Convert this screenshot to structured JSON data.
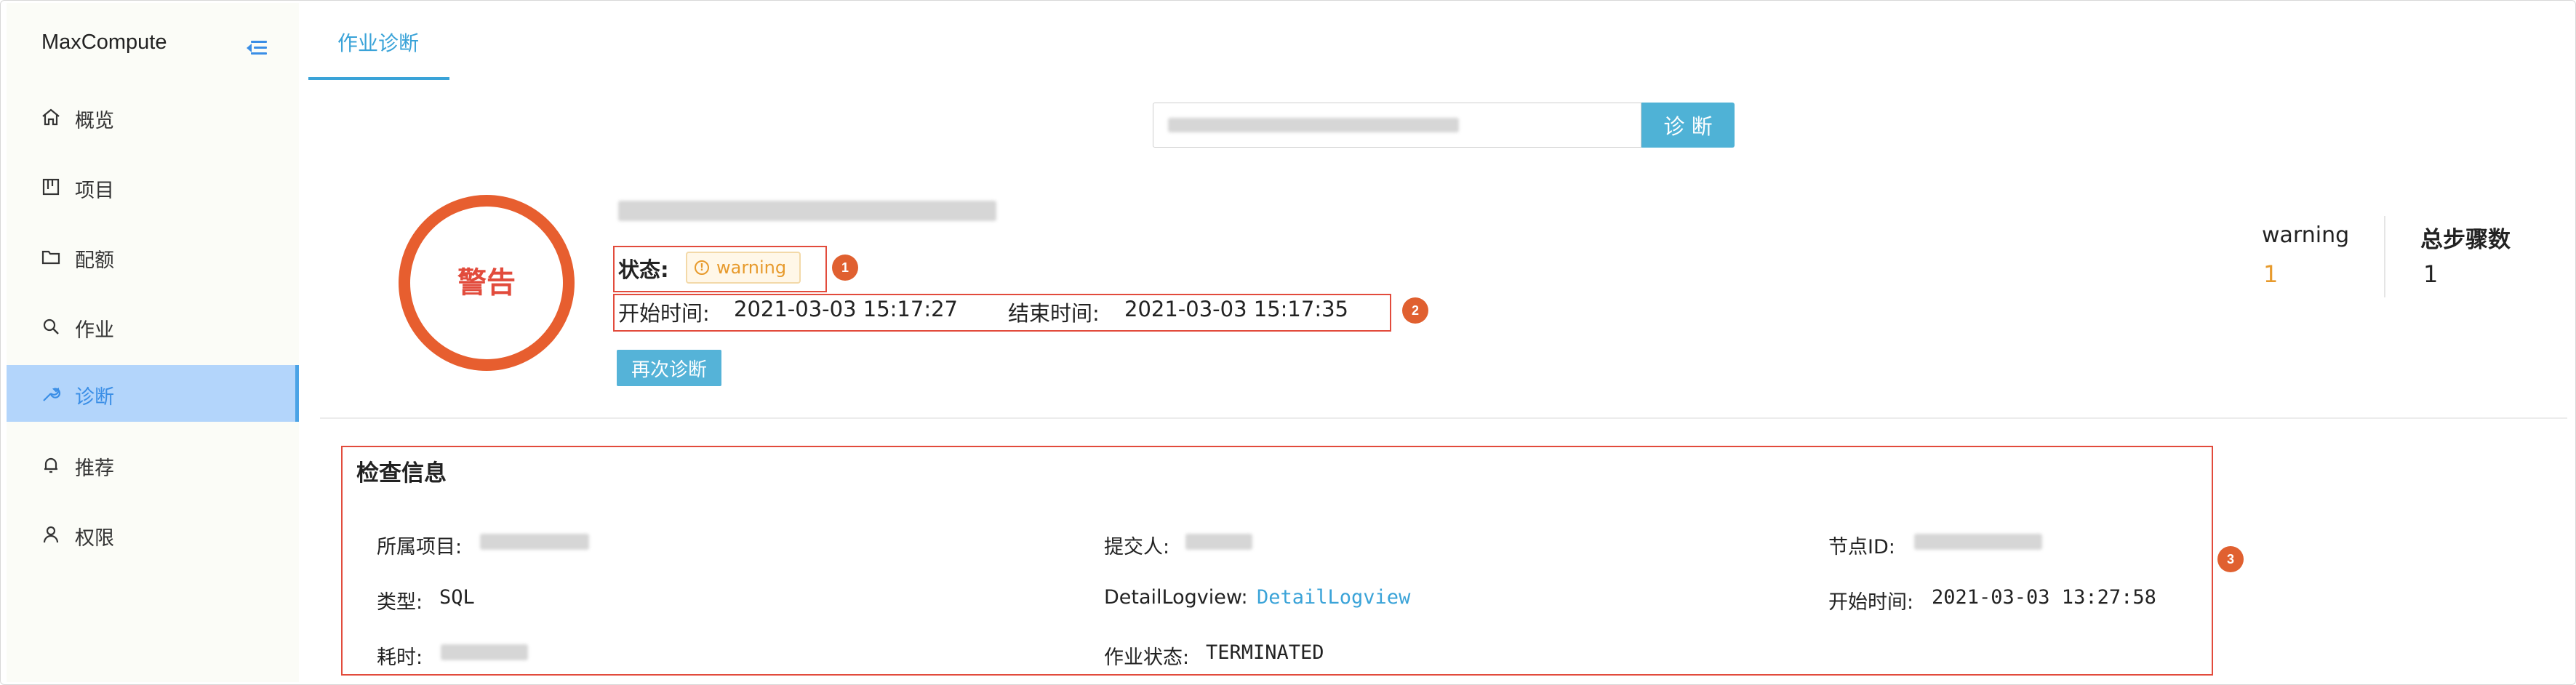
{
  "sidebar": {
    "brand": "MaxCompute",
    "items": [
      {
        "label": "概览",
        "icon": "home-icon"
      },
      {
        "label": "项目",
        "icon": "project-icon"
      },
      {
        "label": "配额",
        "icon": "folder-icon"
      },
      {
        "label": "作业",
        "icon": "search-icon"
      },
      {
        "label": "诊断",
        "icon": "wrench-icon",
        "active": true
      },
      {
        "label": "推荐",
        "icon": "bell-icon"
      },
      {
        "label": "权限",
        "icon": "user-icon"
      }
    ]
  },
  "tab": {
    "label": "作业诊断"
  },
  "search": {
    "button_label": "诊 断"
  },
  "result": {
    "ring_label": "警告",
    "status_label": "状态:",
    "status_value": "warning",
    "start_label": "开始时间:",
    "start_time": "2021-03-03 15:17:27",
    "end_label": "结束时间:",
    "end_time": "2021-03-03 15:17:35",
    "rediagnose_label": "再次诊断"
  },
  "stats": {
    "warning_label": "warning",
    "warning_value": "1",
    "steps_label": "总步骤数",
    "steps_value": "1"
  },
  "check_info": {
    "title": "检查信息",
    "project_label": "所属项目:",
    "submitter_label": "提交人:",
    "node_label": "节点ID:",
    "type_label": "类型:",
    "type_value": "SQL",
    "logview_label": "DetailLogview:",
    "logview_value": "DetailLogview",
    "start_label": "开始时间:",
    "start_value": "2021-03-03 13:27:58",
    "duration_label": "耗时:",
    "job_status_label": "作业状态:",
    "job_status_value": "TERMINATED"
  },
  "annotations": [
    "1",
    "2",
    "3"
  ],
  "colors": {
    "accent": "#3aa3d8",
    "active_bg": "#b3d5fb",
    "warning": "#e79a2c",
    "alert_red": "#e24b3c"
  }
}
